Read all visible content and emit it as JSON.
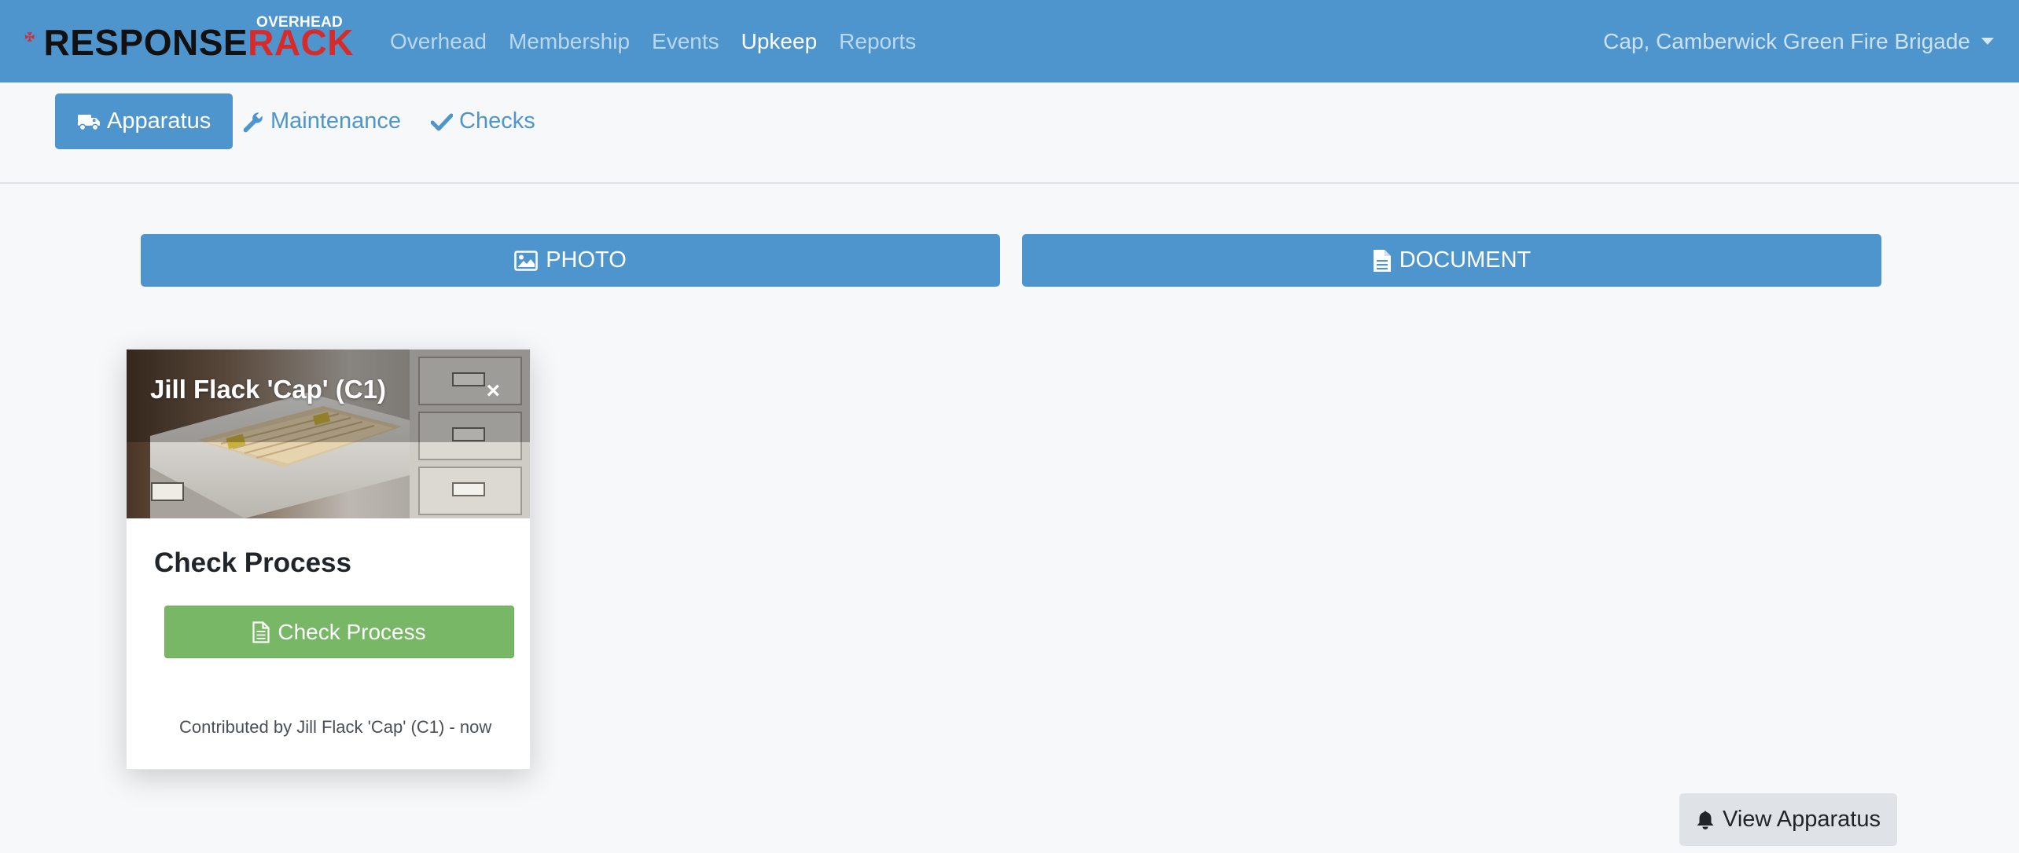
{
  "brand": {
    "word_part1": "RESPONSE",
    "word_part2": "RACK",
    "subtitle": "OVERHEAD",
    "colors": {
      "dark": "#111111",
      "red": "#d92a2a"
    }
  },
  "nav": {
    "items": [
      {
        "label": "Overhead",
        "active": false
      },
      {
        "label": "Membership",
        "active": false
      },
      {
        "label": "Events",
        "active": false
      },
      {
        "label": "Upkeep",
        "active": true
      },
      {
        "label": "Reports",
        "active": false
      }
    ],
    "user_menu": "Cap, Camberwick Green Fire Brigade"
  },
  "subnav": {
    "items": [
      {
        "label": "Apparatus",
        "icon": "truck-icon",
        "active": true
      },
      {
        "label": "Maintenance",
        "icon": "wrench-icon",
        "active": false
      },
      {
        "label": "Checks",
        "icon": "check-icon",
        "active": false
      }
    ]
  },
  "upload": {
    "photo_label": "PHOTO",
    "document_label": "DOCUMENT"
  },
  "card": {
    "header": "Jill Flack 'Cap' (C1)",
    "close": "×",
    "title": "Check Process",
    "button_label": "Check Process",
    "contributed": "Contributed by Jill Flack 'Cap' (C1) - now"
  },
  "view_apparatus_label": "View Apparatus",
  "colors": {
    "primary": "#4e95ce",
    "success": "#77b766",
    "secondary": "#dfe2e6"
  }
}
